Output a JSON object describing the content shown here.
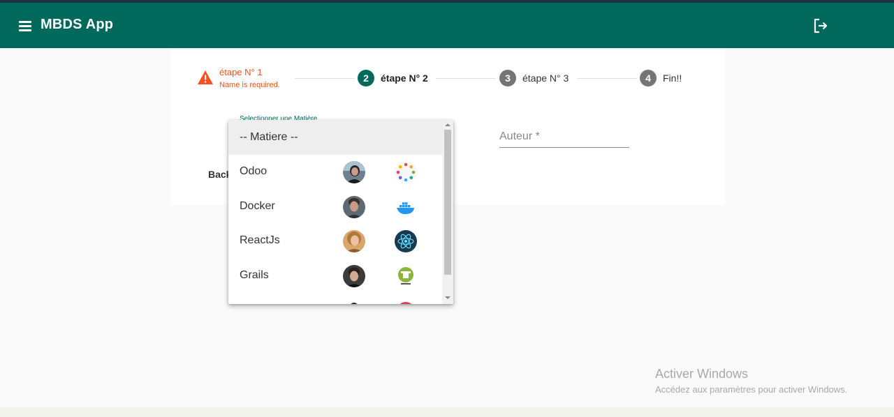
{
  "toolbar": {
    "title": "MBDS App",
    "menu_icon": "menu-icon",
    "logout_icon": "logout-icon",
    "background": "#00695c"
  },
  "stepper": {
    "steps": [
      {
        "label": "étape N° 1",
        "error": "Name is required.",
        "state": "error"
      },
      {
        "number": "2",
        "label": "étape N° 2",
        "state": "active"
      },
      {
        "number": "3",
        "label": "étape N° 3",
        "state": "pending"
      },
      {
        "number": "4",
        "label": "Fin!!",
        "state": "pending"
      }
    ],
    "error_color": "#f4511e",
    "active_color": "#00695c",
    "pending_color": "#757575"
  },
  "form": {
    "matiere_label": "Selectionner une Matière",
    "auteur_placeholder": "Auteur *",
    "back_label": "Back"
  },
  "dropdown": {
    "options": [
      {
        "label": "-- Matiere --",
        "selected": true
      },
      {
        "label": "Odoo",
        "avatar": "professor-avatar",
        "logo": "odoo-logo-icon"
      },
      {
        "label": "Docker",
        "avatar": "professor-avatar",
        "logo": "docker-logo-icon"
      },
      {
        "label": "ReactJs",
        "avatar": "professor-avatar",
        "logo": "react-logo-icon"
      },
      {
        "label": "Grails",
        "avatar": "professor-avatar",
        "logo": "grails-logo-icon"
      }
    ]
  },
  "watermark": {
    "title": "Activer Windows",
    "subtitle": "Accédez aux paramètres pour activer Windows."
  }
}
